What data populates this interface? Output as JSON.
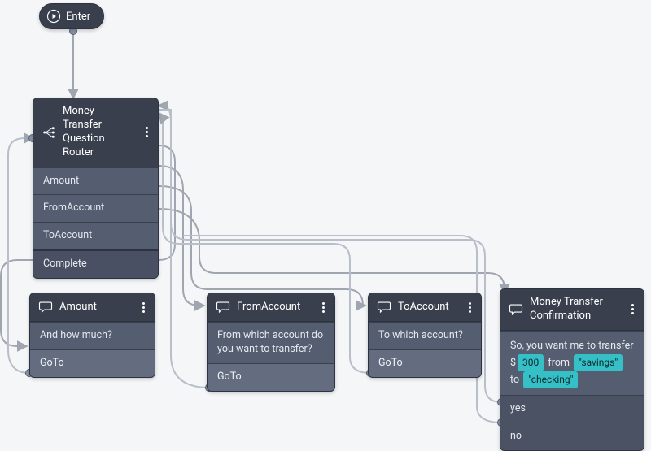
{
  "enter": {
    "label": "Enter"
  },
  "router": {
    "title": "Money Transfer Question Router",
    "rows": {
      "amount": "Amount",
      "fromAccount": "FromAccount",
      "toAccount": "ToAccount",
      "complete": "Complete"
    }
  },
  "amount": {
    "title": "Amount",
    "body": "And how much?",
    "footer": "GoTo"
  },
  "fromAccount": {
    "title": "FromAccount",
    "body": "From which account do you want to transfer?",
    "footer": "GoTo"
  },
  "toAccount": {
    "title": "ToAccount",
    "body": "To which account?",
    "footer": "GoTo"
  },
  "confirmation": {
    "title": "Money Transfer Confirmation",
    "body": {
      "prefix": "So, you want me to transfer $",
      "amount": "300",
      "mid1": " from ",
      "from": "\"savings\"",
      "mid2": " to ",
      "to": "\"checking\""
    },
    "rows": {
      "yes": "yes",
      "no": "no"
    }
  }
}
